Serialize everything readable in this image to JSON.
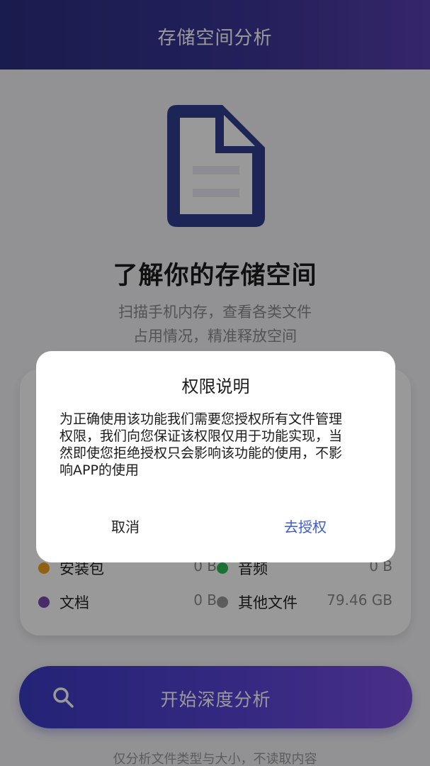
{
  "header": {
    "title": "存储空间分析"
  },
  "hero": {
    "title": "了解你的存储空间",
    "desc_line1": "扫描手机内存，查看各类文件",
    "desc_line2": "占用情况，精准释放空间"
  },
  "storage_card": {
    "items": [
      {
        "label": "安装包",
        "value": "0 B",
        "color": "#f0a020"
      },
      {
        "label": "音频",
        "value": "0 B",
        "color": "#2fbf5b"
      },
      {
        "label": "文档",
        "value": "0 B",
        "color": "#7b4bb0"
      },
      {
        "label": "其他文件",
        "value": "79.46 GB",
        "color": "#9a9a9a"
      }
    ]
  },
  "start_button": {
    "label": "开始深度分析",
    "icon": "search-icon"
  },
  "footnote": "仅分析文件类型与大小，不读取内容",
  "dialog": {
    "title": "权限说明",
    "body_lines": [
      "为正确使用该功能我们需要您授权所有文件管理",
      "权限，我们向您保证该权限仅用于功能实现，当",
      "然即使您拒绝授权只会影响该功能的使用，不影",
      "响APP的使用"
    ],
    "cancel_label": "取消",
    "confirm_label": "去授权"
  },
  "colors": {
    "accent": "#3d5bd6",
    "brand_dark": "#2b2f82",
    "doc_icon": "#2f3f8f"
  }
}
